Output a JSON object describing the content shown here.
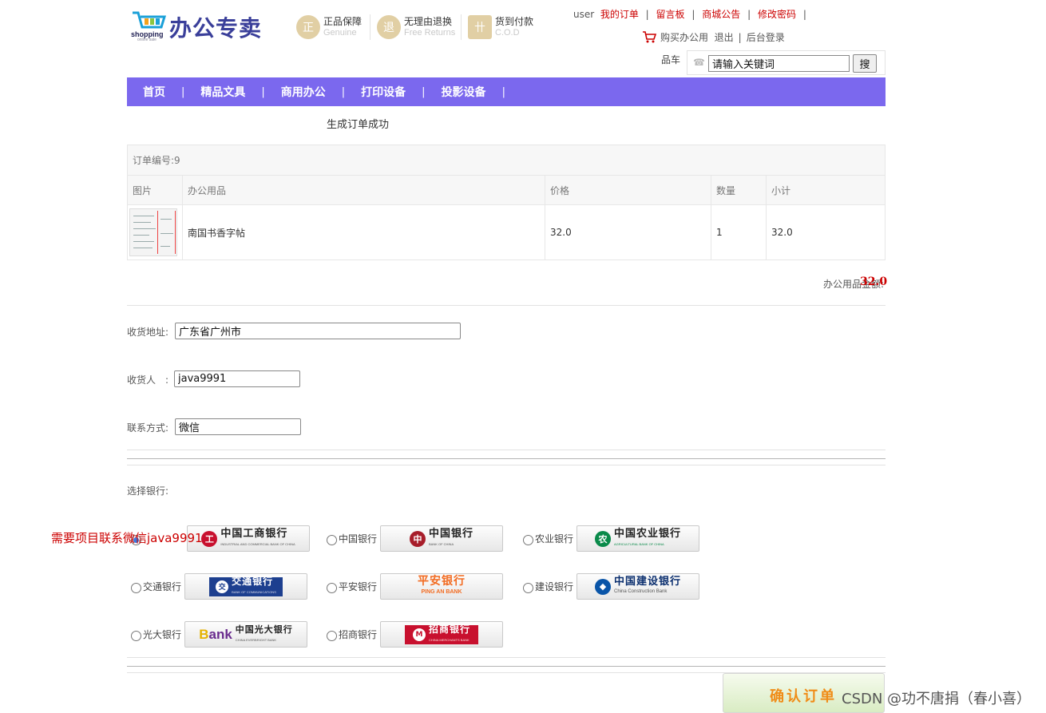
{
  "brand": {
    "cart_logo_text": "shopping",
    "cart_logo_sub": "online sale",
    "title": "办公专卖"
  },
  "badges": [
    {
      "icon": "genuine-icon",
      "glyph": "正",
      "cn": "正品保障",
      "en": "Genuine",
      "color": "#e1cfa4"
    },
    {
      "icon": "return-icon",
      "glyph": "退",
      "cn": "无理由退换",
      "en": "Free Returns",
      "color": "#e1cfa4"
    },
    {
      "icon": "cod-icon",
      "glyph": "卄",
      "cn": "货到付款",
      "en": "C.O.D",
      "color": "#e1cfa4"
    }
  ],
  "user_links": {
    "username": "user",
    "my_orders": "我的订单",
    "message_board": "留言板",
    "announcements": "商城公告",
    "change_password": "修改密码",
    "pipe": "|"
  },
  "account": {
    "cart_link": "购买办公用",
    "logout": "退出",
    "admin_login": "后台登录",
    "pipe": "|"
  },
  "search": {
    "partial_label": "品车",
    "value": "请输入关键词",
    "button": "搜"
  },
  "nav": {
    "items": [
      "首页",
      "精品文具",
      "商用办公",
      "打印设备",
      "投影设备"
    ],
    "separator": "|"
  },
  "success_message": "生成订单成功",
  "order": {
    "number_label": "订单编号:9",
    "columns": [
      "图片",
      "办公用品",
      "价格",
      "数量",
      "小计"
    ],
    "rows": [
      {
        "name": "南国书香字帖",
        "price": "32.0",
        "qty": "1",
        "subtotal": "32.0"
      }
    ],
    "total_label": "办公用品金额:",
    "total_value": "32.0"
  },
  "form": {
    "address_label": "收货地址:",
    "address_value": "广东省广州市",
    "receiver_label": "收货人　:",
    "receiver_value": "java9991",
    "contact_label": "联系方式:",
    "contact_value": "微信"
  },
  "bank_section_label": "选择银行:",
  "banks": [
    {
      "name": "",
      "logo_cn": "中国工商银行",
      "logo_en": "INDUSTRIAL AND COMMERCIAL BANK OF CHINA",
      "mark": "工",
      "color": "#c8102e",
      "selected": true
    },
    {
      "name": "中国银行",
      "logo_cn": "中国银行",
      "logo_en": "BANK OF CHINA",
      "mark": "中",
      "color": "#a71d2a",
      "selected": false
    },
    {
      "name": "农业银行",
      "logo_cn": "中国农业银行",
      "logo_en": "AGRICULTURAL BANK OF CHINA",
      "mark": "农",
      "color": "#0a8a4a",
      "selected": false
    },
    {
      "name": "交通银行",
      "logo_cn": "交通银行",
      "logo_en": "BANK OF COMMUNICATIONS",
      "mark": "交",
      "color": "#1d3f8f",
      "selected": false
    },
    {
      "name": "平安银行",
      "logo_cn": "平安银行",
      "logo_en": "PING AN BANK",
      "mark": "",
      "color": "#f26b21",
      "selected": false
    },
    {
      "name": "建设银行",
      "logo_cn": "中国建设银行",
      "logo_en": "China Construction Bank",
      "mark": "建",
      "color": "#0a55a8",
      "selected": false
    },
    {
      "name": "光大银行",
      "logo_cn": "中国光大银行",
      "logo_en": "CHINA EVERBRIGHT BANK",
      "mark": "B",
      "color": "#6a2c8e",
      "selected": false
    },
    {
      "name": "招商银行",
      "logo_cn": "招商银行",
      "logo_en": "CHINA MERCHANTS BANK",
      "mark": "招",
      "color": "#c8102e",
      "selected": false
    }
  ],
  "promo_text": "需要项目联系微信java9991",
  "confirm_button": "确认订单",
  "watermark": "CSDN @功不唐捐（春小喜）"
}
